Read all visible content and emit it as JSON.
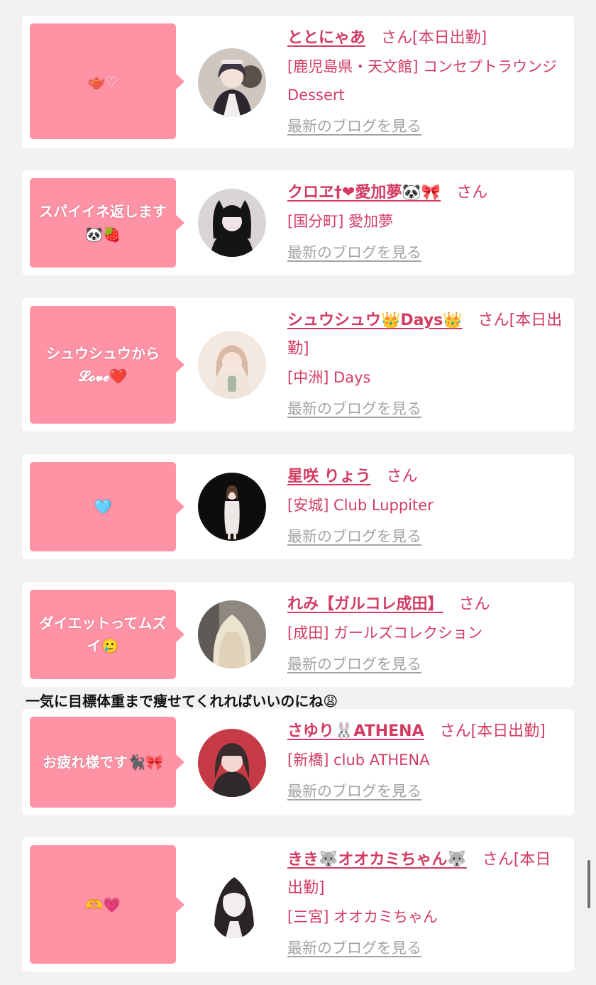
{
  "feed": [
    {
      "message": "🫖♡",
      "name": "ととにゃあ",
      "suffix": "さん[本日出勤]",
      "shop": "[鹿児島県・天文館] コンセプトラウンジ Dessert",
      "blog_link": "最新のブログを見る",
      "avatar_colors": [
        "#3a3540",
        "#efe7e7"
      ]
    },
    {
      "message": "スパイイネ返します🐼🍓",
      "name": "クロヱ†❤愛加夢🐼🎀",
      "suffix": "さん",
      "shop": "[国分町] 愛加夢",
      "blog_link": "最新のブログを見る",
      "avatar_colors": [
        "#141416",
        "#d9d4d8"
      ]
    },
    {
      "message": "シュウシュウから𝓛𝓸𝓿𝓮❤️",
      "name": "シュウシュウ👑Days👑",
      "suffix": "さん[本日出勤]",
      "shop": "[中洲] Days",
      "blog_link": "最新のブログを見る",
      "avatar_colors": [
        "#d9b9a5",
        "#f4e9e1"
      ]
    },
    {
      "message": "🩵",
      "name": "星咲 りょう",
      "suffix": "さん",
      "shop": "[安城] Club Luppiter",
      "blog_link": "最新のブログを見る",
      "avatar_colors": [
        "#0d0d0d",
        "#ece8e6"
      ]
    },
    {
      "message": "ダイエットってムズイ🥲",
      "name": "れみ【ガルコレ成田】",
      "suffix": "さん",
      "shop": "[成田] ガールズコレクション",
      "blog_link": "最新のブログを見る",
      "avatar_colors": [
        "#8e8880",
        "#ece3cf"
      ]
    },
    {
      "message": "お疲れ様です🐈‍⬛🎀",
      "name": "さゆり🐰ATHENA",
      "suffix": "さん[本日出勤]",
      "shop": "[新橋] club ATHENA",
      "blog_link": "最新のブログを見る",
      "avatar_colors": [
        "#c53a44",
        "#f1d7cf"
      ]
    },
    {
      "message": "🫶💗",
      "name": "きき🐺オオカミちゃん🐺",
      "suffix": "さん[本日出勤]",
      "shop": "[三宮] オオカミちゃん",
      "blog_link": "最新のブログを見る",
      "avatar_colors": [
        "#2a2426",
        "#f3eeee"
      ]
    }
  ],
  "comment": "一気に目標体重まで痩せてくれればいいのにね😩",
  "colors": {
    "accent": "#d23c63",
    "bubble": "#ff93a6",
    "link_gray": "#a3a3a3",
    "background": "#f2f2f2"
  }
}
